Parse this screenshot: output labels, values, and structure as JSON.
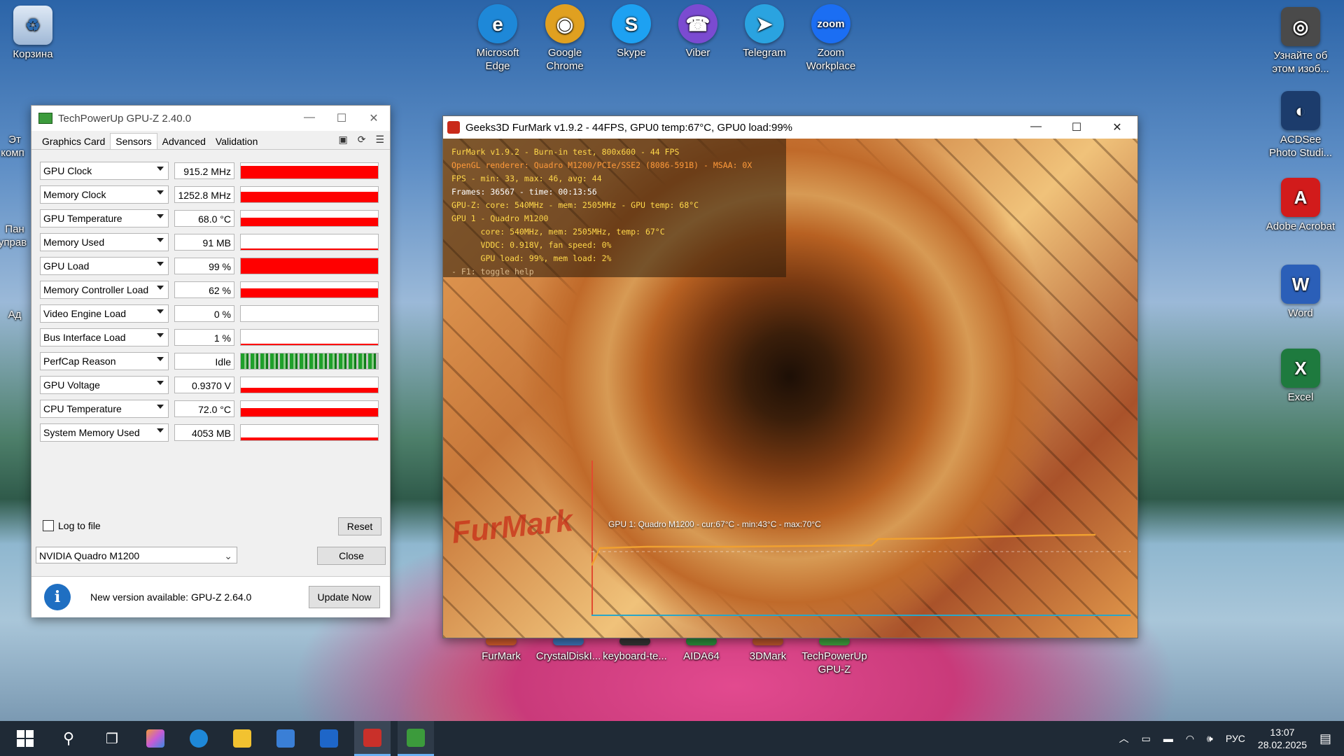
{
  "desktop": {
    "left_icons": [
      {
        "label": "Корзина",
        "icon": "recycle-bin-icon"
      }
    ],
    "partial_labels": {
      "a": "Эт",
      "b": "комп",
      "c": "Пан",
      "d": "управ",
      "e": "Ад"
    },
    "top_icons": [
      {
        "label": "Microsoft Edge",
        "color": "#1e88d8",
        "glyph": "e"
      },
      {
        "label": "Google Chrome",
        "color": "#e0a020",
        "glyph": "◉"
      },
      {
        "label": "Skype",
        "color": "#1da1f2",
        "glyph": "S"
      },
      {
        "label": "Viber",
        "color": "#7b4bd1",
        "glyph": "☎"
      },
      {
        "label": "Telegram",
        "color": "#2aa3e0",
        "glyph": "➤"
      },
      {
        "label": "Zoom Workplace",
        "color": "#1b6ef3",
        "glyph": "zoom"
      }
    ],
    "right_icons": [
      {
        "label": "Узнайте об этом изоб...",
        "color": "#4a4a4a",
        "glyph": "◎"
      },
      {
        "label": "ACDSee Photo Studi...",
        "color": "#1c3c6c",
        "glyph": "◐"
      },
      {
        "label": "Adobe Acrobat",
        "color": "#d21b1b",
        "glyph": "A"
      },
      {
        "label": "Word",
        "color": "#2b5fb8",
        "glyph": "W"
      },
      {
        "label": "Excel",
        "color": "#1e7a3e",
        "glyph": "X"
      }
    ],
    "bottom_icons": [
      {
        "label": "FurMark",
        "color": "#c9582a"
      },
      {
        "label": "CrystalDiskI...",
        "color": "#3a6fb0"
      },
      {
        "label": "keyboard-te...",
        "color": "#333333"
      },
      {
        "label": "AIDA64",
        "color": "#2a8a3a"
      },
      {
        "label": "3DMark",
        "color": "#b5532a"
      },
      {
        "label": "TechPowerUp GPU-Z",
        "color": "#3c9b3c"
      }
    ]
  },
  "gpuz": {
    "title": "TechPowerUp GPU-Z 2.40.0",
    "tabs": [
      "Graphics Card",
      "Sensors",
      "Advanced",
      "Validation"
    ],
    "active_tab": "Sensors",
    "sensors": [
      {
        "name": "GPU Clock",
        "value": "915.2 MHz",
        "level": 0.8
      },
      {
        "name": "Memory Clock",
        "value": "1252.8 MHz",
        "level": 0.7
      },
      {
        "name": "GPU Temperature",
        "value": "68.0 °C",
        "level": 0.55
      },
      {
        "name": "Memory Used",
        "value": "91 MB",
        "level": 0.05
      },
      {
        "name": "GPU Load",
        "value": "99 %",
        "level": 0.99
      },
      {
        "name": "Memory Controller Load",
        "value": "62 %",
        "level": 0.6
      },
      {
        "name": "Video Engine Load",
        "value": "0 %",
        "level": 0.0
      },
      {
        "name": "Bus Interface Load",
        "value": "1 %",
        "level": 0.02
      },
      {
        "name": "PerfCap Reason",
        "value": "Idle",
        "level": 1.0
      },
      {
        "name": "GPU Voltage",
        "value": "0.9370 V",
        "level": 0.3
      },
      {
        "name": "CPU Temperature",
        "value": "72.0 °C",
        "level": 0.55
      },
      {
        "name": "System Memory Used",
        "value": "4053 MB",
        "level": 0.18
      }
    ],
    "log_to_file": "Log to file",
    "reset": "Reset",
    "gpu_select": "NVIDIA Quadro M1200",
    "close": "Close",
    "notice": "New version available: GPU-Z 2.64.0",
    "update_now": "Update Now"
  },
  "furmark": {
    "title": "Geeks3D FurMark v1.9.2 - 44FPS, GPU0 temp:67°C, GPU0 load:99%",
    "overlay": [
      {
        "text": "FurMark v1.9.2 - Burn-in test, 800x600 - 44 FPS",
        "color": "#ffd84a"
      },
      {
        "text": "OpenGL renderer: Quadro M1200/PCIe/SSE2 (8086-591B) - MSAA: 0X",
        "color": "#ff9a3a"
      },
      {
        "text": "FPS - min: 33, max: 46, avg: 44",
        "color": "#ffd84a"
      },
      {
        "text": "Frames: 36567 - time: 00:13:56",
        "color": "#ffffff"
      },
      {
        "text": "GPU-Z: core: 540MHz - mem: 2505MHz - GPU temp: 68°C",
        "color": "#ffd84a"
      },
      {
        "text": "GPU 1 - Quadro M1200",
        "color": "#ffd84a"
      },
      {
        "text": "      core: 540MHz, mem: 2505MHz, temp: 67°C",
        "color": "#ffd84a"
      },
      {
        "text": "      VDDC: 0.918V, fan speed: 0%",
        "color": "#ffd84a"
      },
      {
        "text": "      GPU load: 99%, mem load: 2%",
        "color": "#ffd84a"
      },
      {
        "text": "- F1: toggle help",
        "color": "#d9b88a"
      }
    ],
    "graph_label": "GPU 1: Quadro M1200 - cur:67°C - min:43°C - max:70°C",
    "logo": "FurMark"
  },
  "taskbar": {
    "apps": [
      {
        "name": "start-button",
        "color": "#ffffff"
      },
      {
        "name": "search-button",
        "color": "#ffffff"
      },
      {
        "name": "task-view-button",
        "color": "#ffffff"
      },
      {
        "name": "copilot-button",
        "color": "#c65bd6"
      },
      {
        "name": "edge-button",
        "color": "#1e88d8"
      },
      {
        "name": "explorer-button",
        "color": "#f2c230"
      },
      {
        "name": "store-button",
        "color": "#3a7fd6"
      },
      {
        "name": "outlook-button",
        "color": "#1e66c8"
      },
      {
        "name": "furmark-button",
        "color": "#c9302a"
      },
      {
        "name": "gpuz-button",
        "color": "#3c9b3c"
      }
    ],
    "lang": "РУС",
    "time": "13:07",
    "date": "28.02.2025"
  }
}
